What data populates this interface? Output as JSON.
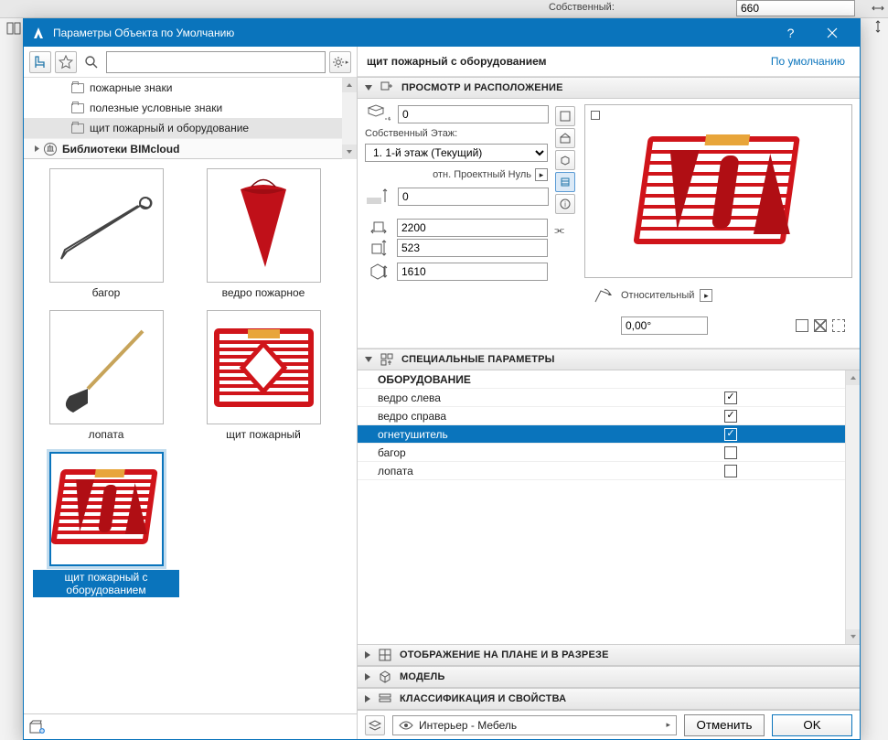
{
  "background": {
    "own_label": "Собственный:",
    "own_value": "660"
  },
  "dialog": {
    "title": "Параметры Объекта по Умолчанию",
    "search_placeholder": "",
    "tree": {
      "items": [
        {
          "label": "пожарные знаки"
        },
        {
          "label": "полезные условные знаки"
        },
        {
          "label": "щит пожарный и оборудование"
        }
      ],
      "lib_label": "Библиотеки BIMcloud"
    },
    "library": [
      {
        "label": "багор"
      },
      {
        "label": "ведро пожарное"
      },
      {
        "label": "лопата"
      },
      {
        "label": "щит пожарный"
      },
      {
        "label": "щит пожарный с оборудованием"
      }
    ],
    "right": {
      "object_name": "щит пожарный с оборудованием",
      "default_label": "По умолчанию",
      "section1": {
        "title": "ПРОСМОТР И РАСПОЛОЖЕНИЕ",
        "z_value": "0",
        "floor_label": "Собственный Этаж:",
        "floor_value": "1. 1-й этаж (Текущий)",
        "proj_zero_label": "отн. Проектный Нуль",
        "proj_zero_value": "0",
        "width": "2200",
        "depth": "523",
        "height": "1610",
        "relative_label": "Относительный",
        "angle": "0,00°"
      },
      "section2": {
        "title": "СПЕЦИАЛЬНЫЕ ПАРАМЕТРЫ",
        "group_title": "ОБОРУДОВАНИЕ",
        "rows": [
          {
            "label": "ведро слева",
            "checked": true
          },
          {
            "label": "ведро справа",
            "checked": true
          },
          {
            "label": "огнетушитель",
            "checked": true,
            "selected": true
          },
          {
            "label": "багор",
            "checked": false
          },
          {
            "label": "лопата",
            "checked": false
          }
        ]
      },
      "section3": {
        "title": "ОТОБРАЖЕНИЕ НА ПЛАНЕ И В РАЗРЕЗЕ"
      },
      "section4": {
        "title": "МОДЕЛЬ"
      },
      "section5": {
        "title": "КЛАССИФИКАЦИЯ И СВОЙСТВА"
      },
      "footer": {
        "layer": "Интерьер - Мебель",
        "cancel": "Отменить",
        "ok": "OK"
      }
    }
  }
}
